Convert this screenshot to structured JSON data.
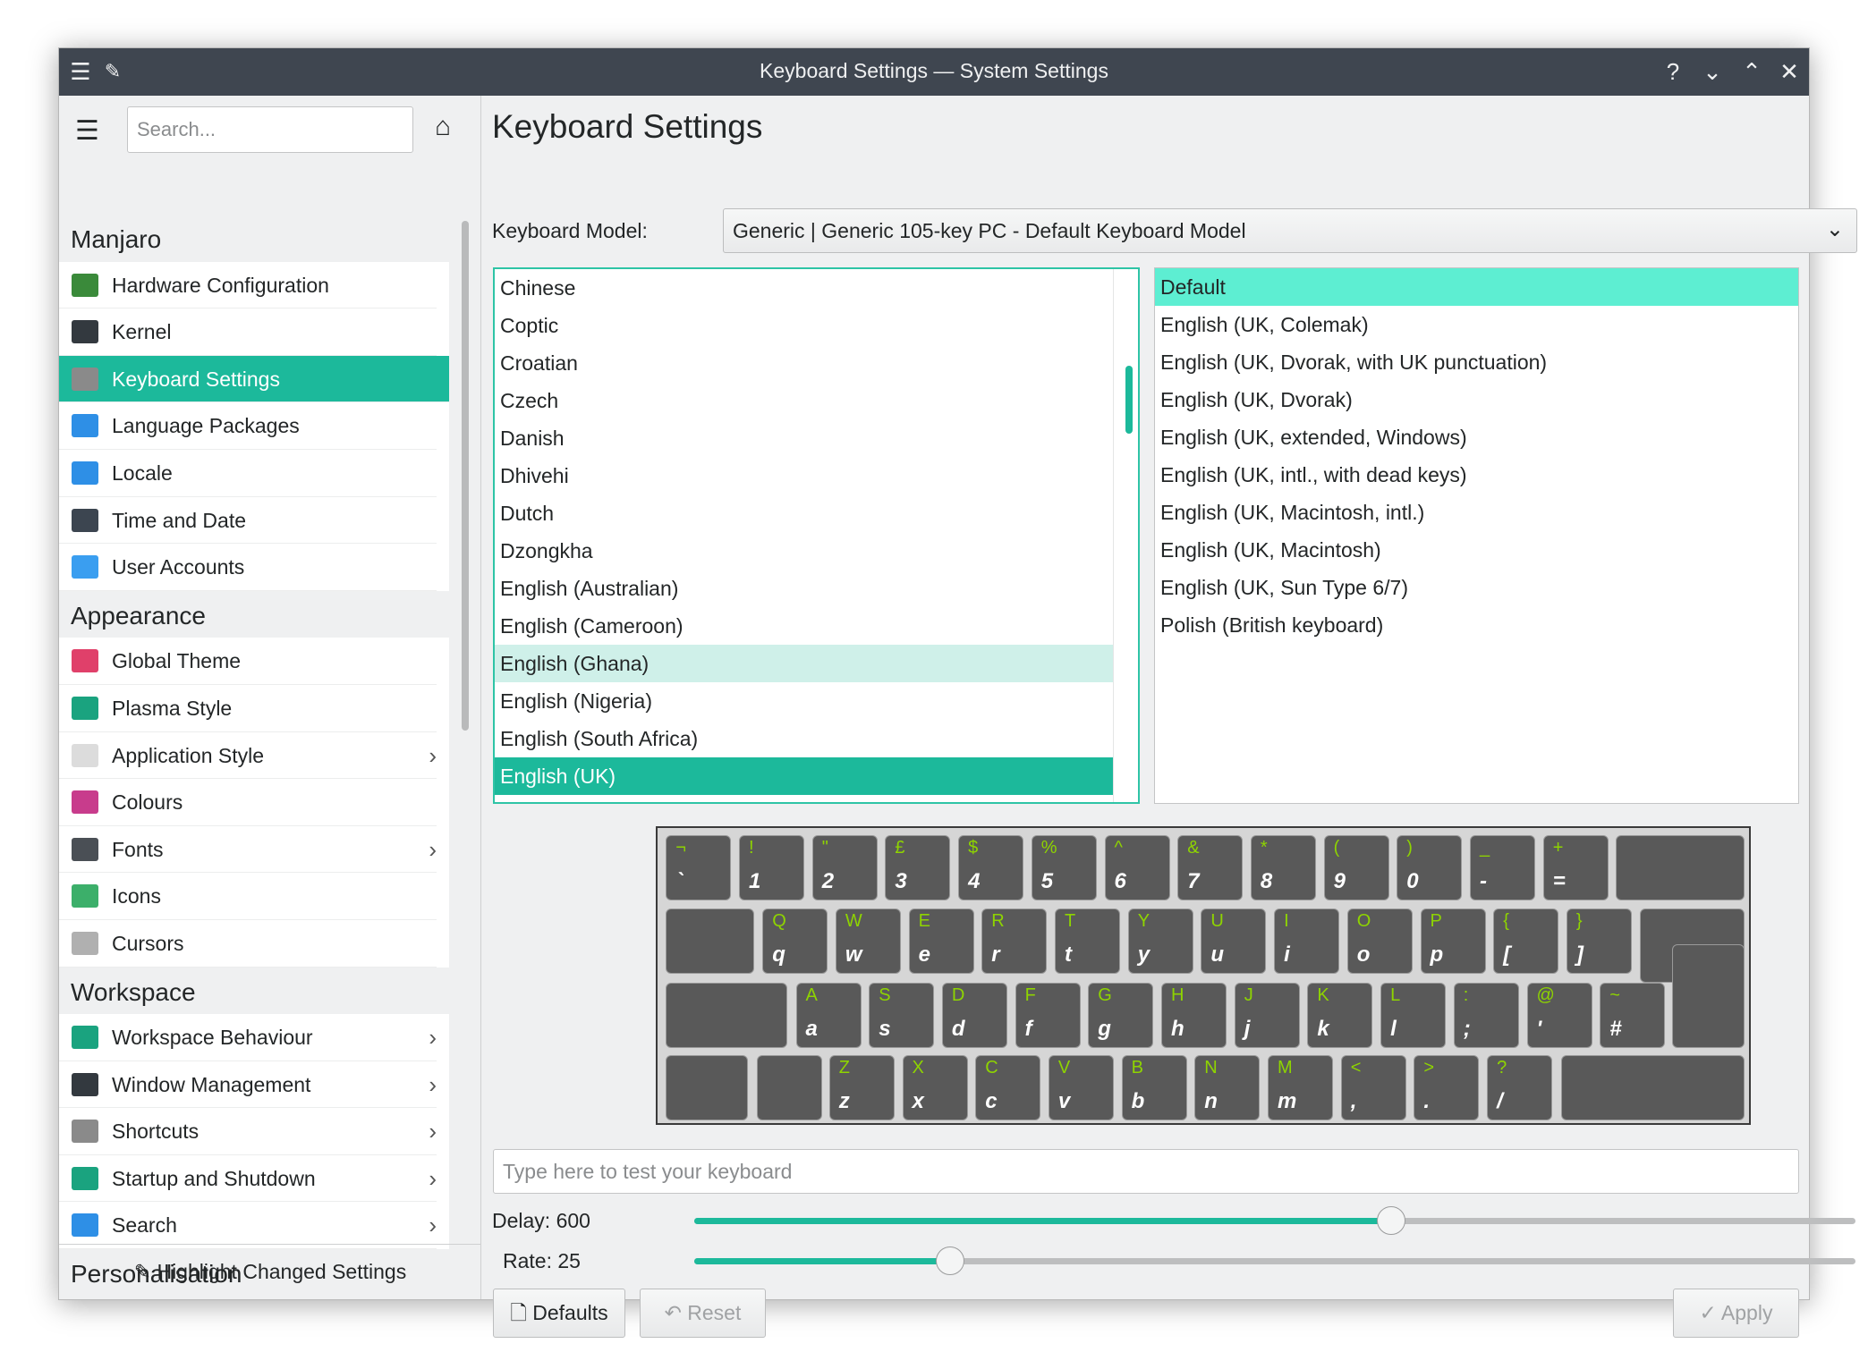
{
  "window": {
    "title": "Keyboard Settings — System Settings"
  },
  "sidebar": {
    "search_placeholder": "Search...",
    "highlight_label": "Highlight Changed Settings",
    "groups": [
      {
        "title": "Manjaro",
        "items": [
          {
            "label": "Hardware Configuration",
            "icon": "hardware-icon",
            "color": "#3a8a3a"
          },
          {
            "label": "Kernel",
            "icon": "kernel-icon",
            "color": "#33393f"
          },
          {
            "label": "Keyboard Settings",
            "icon": "keyboard-icon",
            "color": "#8a8a8a",
            "selected": true
          },
          {
            "label": "Language Packages",
            "icon": "language-icon",
            "color": "#2e8fe6"
          },
          {
            "label": "Locale",
            "icon": "locale-icon",
            "color": "#2e8fe6"
          },
          {
            "label": "Time and Date",
            "icon": "clock-icon",
            "color": "#3c4550"
          },
          {
            "label": "User Accounts",
            "icon": "user-icon",
            "color": "#3a9ef0"
          }
        ]
      },
      {
        "title": "Appearance",
        "items": [
          {
            "label": "Global Theme",
            "icon": "global-theme-icon",
            "color": "#e0406a"
          },
          {
            "label": "Plasma Style",
            "icon": "plasma-style-icon",
            "color": "#1aa37f"
          },
          {
            "label": "Application Style",
            "icon": "application-style-icon",
            "color": "#dcdcdc",
            "sub": true
          },
          {
            "label": "Colours",
            "icon": "colours-icon",
            "color": "#c83c8c"
          },
          {
            "label": "Fonts",
            "icon": "fonts-icon",
            "color": "#4a4f55",
            "sub": true
          },
          {
            "label": "Icons",
            "icon": "icons-icon",
            "color": "#3caf6a"
          },
          {
            "label": "Cursors",
            "icon": "cursors-icon",
            "color": "#b0b0b0"
          }
        ]
      },
      {
        "title": "Workspace",
        "items": [
          {
            "label": "Workspace Behaviour",
            "icon": "workspace-icon",
            "color": "#1aa37f",
            "sub": true
          },
          {
            "label": "Window Management",
            "icon": "window-icon",
            "color": "#33393f",
            "sub": true
          },
          {
            "label": "Shortcuts",
            "icon": "shortcuts-icon",
            "color": "#8a8a8a",
            "sub": true
          },
          {
            "label": "Startup and Shutdown",
            "icon": "startup-icon",
            "color": "#1aa37f",
            "sub": true
          },
          {
            "label": "Search",
            "icon": "search-icon",
            "color": "#2e8fe6",
            "sub": true
          }
        ]
      },
      {
        "title": "Personalisation",
        "items": []
      }
    ]
  },
  "main": {
    "title": "Keyboard Settings",
    "model_label": "Keyboard Model:",
    "model_value": "Generic | Generic 105-key PC - Default Keyboard Model",
    "languages": [
      "Chinese",
      "Coptic",
      "Croatian",
      "Czech",
      "Danish",
      "Dhivehi",
      "Dutch",
      "Dzongkha",
      "English (Australian)",
      "English (Cameroon)",
      "English (Ghana)",
      "English (Nigeria)",
      "English (South Africa)",
      "English (UK)"
    ],
    "languages_hovered": "English (Ghana)",
    "languages_selected": "English (UK)",
    "variants": [
      "Default",
      "English (UK, Colemak)",
      "English (UK, Dvorak, with UK punctuation)",
      "English (UK, Dvorak)",
      "English (UK, extended, Windows)",
      "English (UK, intl., with dead keys)",
      "English (UK, Macintosh, intl.)",
      "English (UK, Macintosh)",
      "English (UK, Sun Type 6/7)",
      "Polish (British keyboard)"
    ],
    "variants_selected": "Default",
    "keyboard": {
      "rows": [
        [
          [
            "¬",
            "`"
          ],
          [
            "!",
            "1"
          ],
          [
            "\"",
            "2"
          ],
          [
            "£",
            "3"
          ],
          [
            "$",
            "4"
          ],
          [
            "%",
            "5"
          ],
          [
            "^",
            "6"
          ],
          [
            "&",
            "7"
          ],
          [
            "*",
            "8"
          ],
          [
            "(",
            "9"
          ],
          [
            ")",
            "0"
          ],
          [
            "_",
            "-"
          ],
          [
            "+",
            "="
          ]
        ],
        [
          [
            "Q",
            "q"
          ],
          [
            "W",
            "w"
          ],
          [
            "E",
            "e"
          ],
          [
            "R",
            "r"
          ],
          [
            "T",
            "t"
          ],
          [
            "Y",
            "y"
          ],
          [
            "U",
            "u"
          ],
          [
            "I",
            "i"
          ],
          [
            "O",
            "o"
          ],
          [
            "P",
            "p"
          ],
          [
            "{",
            "["
          ],
          [
            "}",
            "]"
          ]
        ],
        [
          [
            "A",
            "a"
          ],
          [
            "S",
            "s"
          ],
          [
            "D",
            "d"
          ],
          [
            "F",
            "f"
          ],
          [
            "G",
            "g"
          ],
          [
            "H",
            "h"
          ],
          [
            "J",
            "j"
          ],
          [
            "K",
            "k"
          ],
          [
            "L",
            "l"
          ],
          [
            ":",
            ";"
          ],
          [
            "@",
            "'"
          ],
          [
            "~",
            "#"
          ]
        ],
        [
          [
            "Z",
            "z"
          ],
          [
            "X",
            "x"
          ],
          [
            "C",
            "c"
          ],
          [
            "V",
            "v"
          ],
          [
            "B",
            "b"
          ],
          [
            "N",
            "n"
          ],
          [
            "M",
            "m"
          ],
          [
            "<",
            ","
          ],
          [
            ">",
            "."
          ],
          [
            "?",
            "/"
          ]
        ]
      ]
    },
    "test_placeholder": "Type here to test your keyboard",
    "delay_label": "Delay:",
    "delay_value": "600",
    "delay_fraction": 0.6,
    "rate_label": "Rate:",
    "rate_value": "25",
    "rate_fraction": 0.22,
    "defaults_label": "Defaults",
    "reset_label": "Reset",
    "apply_label": "Apply"
  }
}
